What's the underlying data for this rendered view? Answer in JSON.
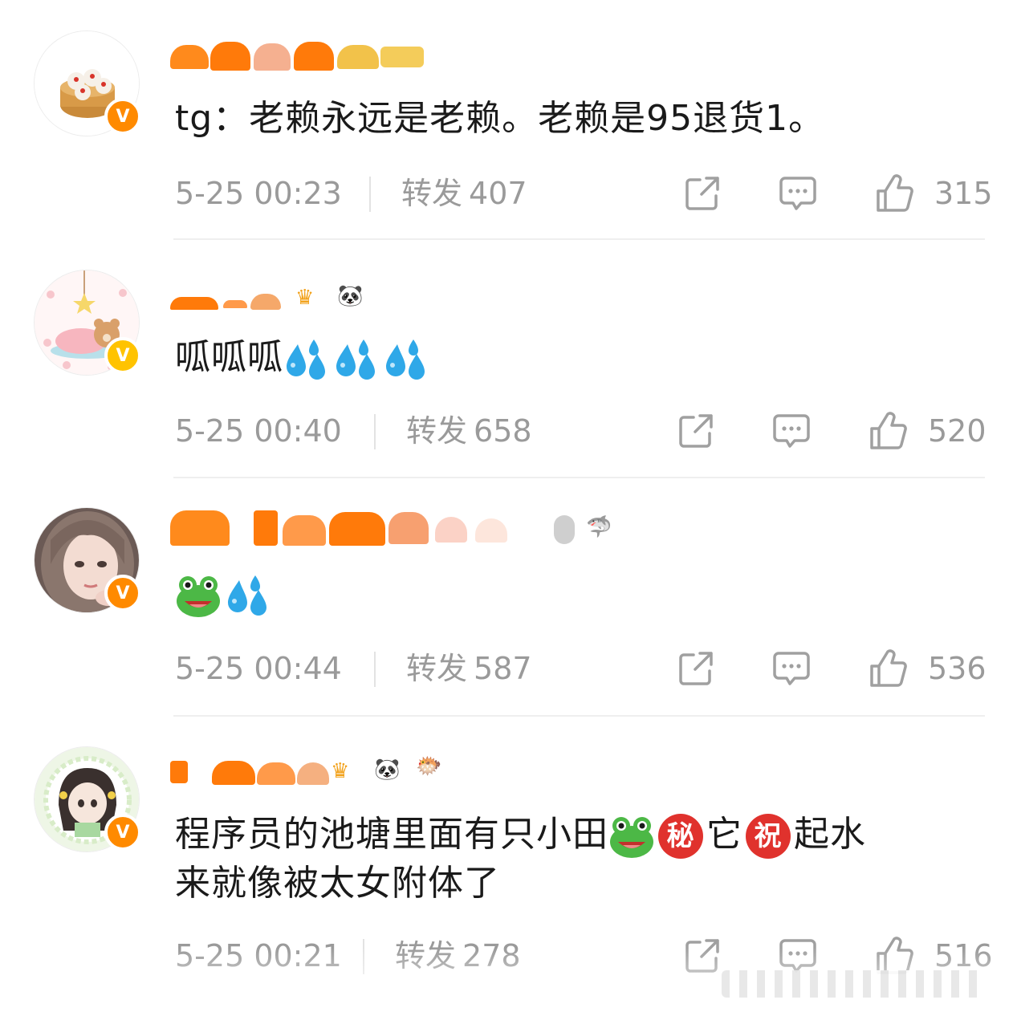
{
  "colors": {
    "vip_orange": "#ff8a00",
    "vip_gold": "#ffc300",
    "meta_gray": "#9a9a9a",
    "drop_blue": "#2fa8e8",
    "frog_green": "#4cb846",
    "seal_red": "#e0322d"
  },
  "comments": [
    {
      "avatar": "steamed-buns-avatar",
      "text": "tg：老赖永远是老赖。老赖是95退货1。",
      "time": "5-25 00:23",
      "repost_label": "转发",
      "repost_count": "407",
      "likes": "315"
    },
    {
      "avatar": "sleeping-bear-avatar",
      "text": "呱呱呱",
      "emoji": [
        "sweat-drops-icon",
        "sweat-drops-icon",
        "sweat-drops-icon"
      ],
      "time": "5-25 00:40",
      "repost_label": "转发",
      "repost_count": "658",
      "likes": "520"
    },
    {
      "avatar": "girl-portrait-avatar",
      "text": "",
      "emoji": [
        "frog-icon",
        "sweat-drops-icon"
      ],
      "time": "5-25 00:44",
      "repost_label": "转发",
      "repost_count": "587",
      "likes": "536"
    },
    {
      "avatar": "anime-girl-avatar",
      "text_part1": "程序员的池塘里面有只小田",
      "seal1": "秘",
      "text_part2": "它",
      "seal2": "祝",
      "text_part3": "起水",
      "text_line2": "来就像被太女附体了",
      "time": "5-25 00:21",
      "repost_label": "转发",
      "repost_count": "278",
      "likes": "516"
    }
  ],
  "badge_letter": "V"
}
